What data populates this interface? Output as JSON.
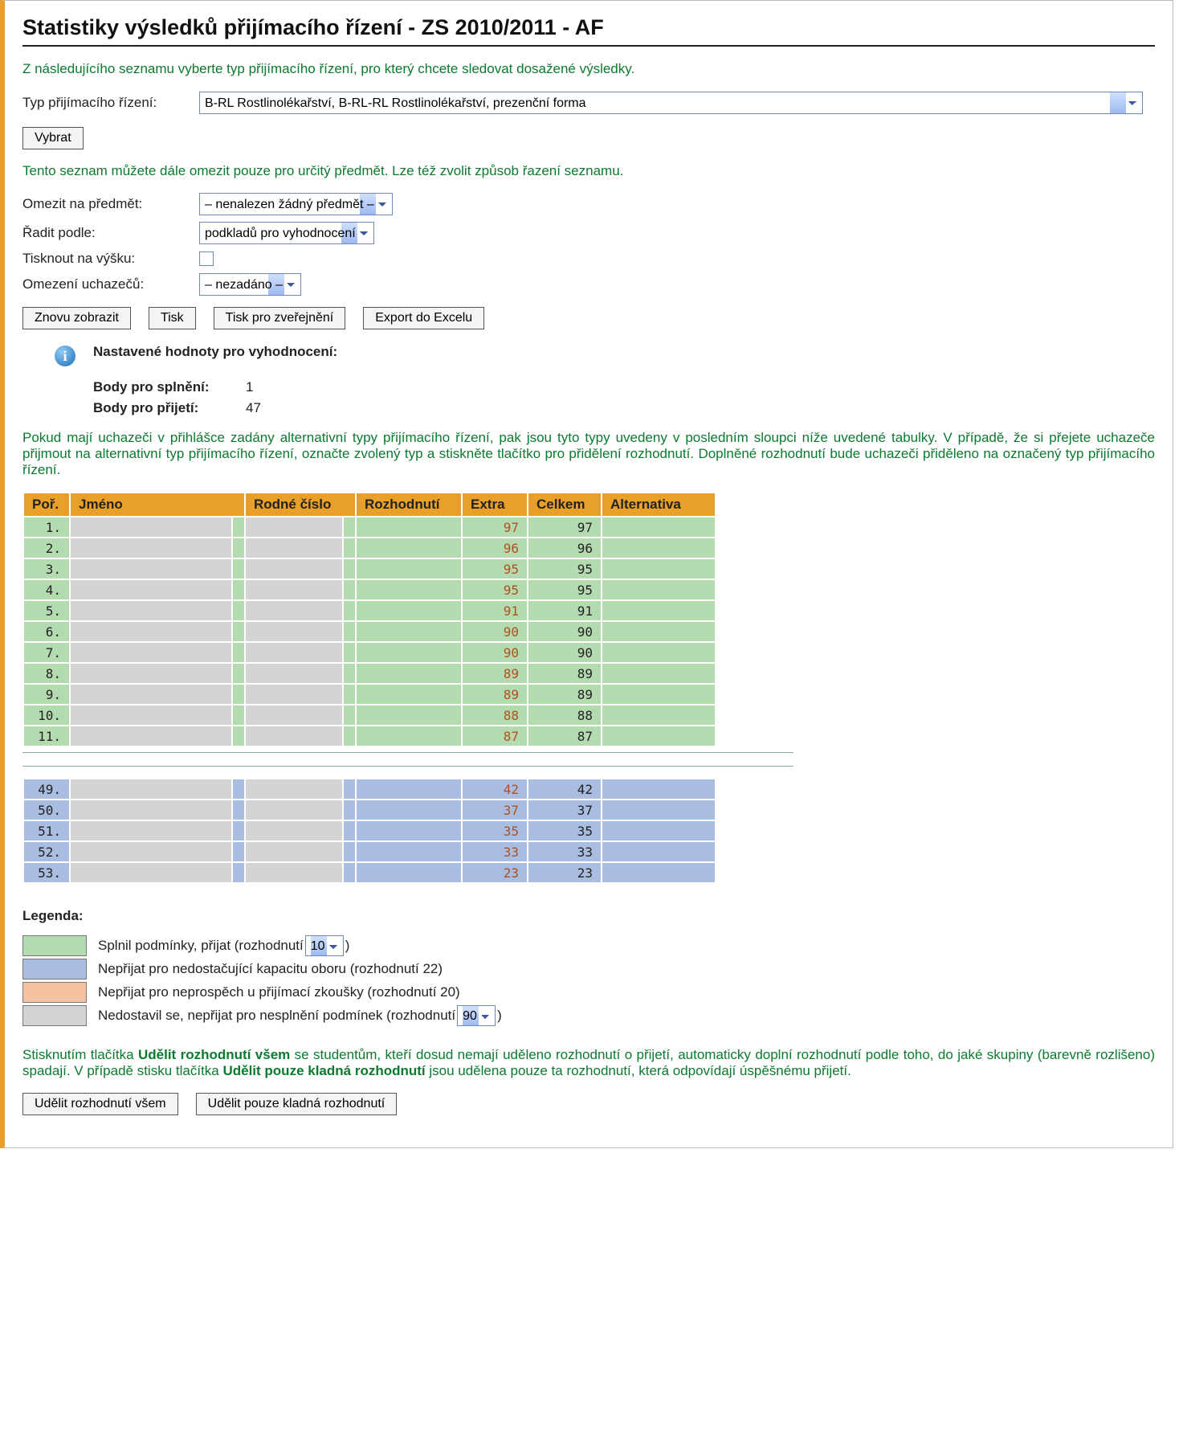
{
  "title": "Statistiky výsledků přijímacího řízení - ZS 2010/2011 - AF",
  "intro": "Z následujícího seznamu vyberte typ přijímacího řízení, pro který chcete sledovat dosažené výsledky.",
  "typeRow": {
    "label": "Typ přijímacího řízení:",
    "value": "B-RL Rostlinolékařství, B-RL-RL Rostlinolékařství, prezenční forma"
  },
  "btnSelect": "Vybrat",
  "limitNote": "Tento seznam můžete dále omezit pouze pro určitý předmět. Lze též zvolit způsob řazení seznamu.",
  "filters": {
    "subjectLabel": "Omezit na předmět:",
    "subjectValue": "– nenalezen žádný předmět –",
    "sortLabel": "Řadit podle:",
    "sortValue": "podkladů pro vyhodnocení",
    "printLabel": "Tisknout na výšku:",
    "limitAppLabel": "Omezení uchazečů:",
    "limitAppValue": "– nezadáno –"
  },
  "btns": {
    "refresh": "Znovu zobrazit",
    "print": "Tisk",
    "printPub": "Tisk pro zveřejnění",
    "export": "Export do Excelu"
  },
  "infoHeading": "Nastavené hodnoty pro vyhodnocení:",
  "infoKV": [
    {
      "k": "Body pro splnění:",
      "v": "1"
    },
    {
      "k": "Body pro přijetí:",
      "v": "47"
    }
  ],
  "altNote": "Pokud mají uchazeči v přihlášce zadány alternativní typy přijímacího řízení, pak jsou tyto typy uvedeny v posledním sloupci níže uvedené tabulky. V případě, že si přejete uchazeče přijmout na alternativní typ přijímacího řízení, označte zvolený typ a stiskněte tlačítko pro přidělení rozhodnutí. Doplněné rozhodnutí bude uchazeči přiděleno na označený typ přijímacího řízení.",
  "table": {
    "headers": [
      "Poř.",
      "Jméno",
      "Rodné číslo",
      "Rozhodnutí",
      "Extra",
      "Celkem",
      "Alternativa"
    ],
    "rowsTop": [
      {
        "n": "1.",
        "extra": "97",
        "celkem": "97"
      },
      {
        "n": "2.",
        "extra": "96",
        "celkem": "96"
      },
      {
        "n": "3.",
        "extra": "95",
        "celkem": "95"
      },
      {
        "n": "4.",
        "extra": "95",
        "celkem": "95"
      },
      {
        "n": "5.",
        "extra": "91",
        "celkem": "91"
      },
      {
        "n": "6.",
        "extra": "90",
        "celkem": "90"
      },
      {
        "n": "7.",
        "extra": "90",
        "celkem": "90"
      },
      {
        "n": "8.",
        "extra": "89",
        "celkem": "89"
      },
      {
        "n": "9.",
        "extra": "89",
        "celkem": "89"
      },
      {
        "n": "10.",
        "extra": "88",
        "celkem": "88"
      },
      {
        "n": "11.",
        "extra": "87",
        "celkem": "87"
      }
    ],
    "rowsBottom": [
      {
        "n": "49.",
        "extra": "42",
        "celkem": "42"
      },
      {
        "n": "50.",
        "extra": "37",
        "celkem": "37"
      },
      {
        "n": "51.",
        "extra": "35",
        "celkem": "35"
      },
      {
        "n": "52.",
        "extra": "33",
        "celkem": "33"
      },
      {
        "n": "53.",
        "extra": "23",
        "celkem": "23"
      }
    ]
  },
  "legend": {
    "title": "Legenda:",
    "items": [
      {
        "swatch": "green",
        "prefix": "Splnil podmínky, přijat (rozhodnutí ",
        "select": "10",
        "suffix": ")"
      },
      {
        "swatch": "blue",
        "text": "Nepřijat pro nedostačující kapacitu oboru (rozhodnutí 22)"
      },
      {
        "swatch": "orange",
        "text": "Nepřijat pro neprospěch u přijímací zkoušky (rozhodnutí 20)"
      },
      {
        "swatch": "gray",
        "prefix": "Nedostavil se, nepřijat pro nesplnění podmínek (rozhodnutí ",
        "select": "90",
        "suffix": ")"
      }
    ]
  },
  "grantNote": {
    "p1a": "Stisknutím tlačítka ",
    "b1": "Udělit rozhodnutí všem",
    "p1b": " se studentům, kteří dosud nemají uděleno rozhodnutí o přijetí, automaticky doplní rozhodnutí podle toho, do jaké skupiny (barevně rozlišeno) spadají. V případě stisku tlačítka ",
    "b2": "Udělit pouze kladná rozhodnutí",
    "p1c": " jsou udělena pouze ta rozhodnutí, která odpovídají úspěšnému přijetí."
  },
  "grantBtns": {
    "all": "Udělit rozhodnutí všem",
    "positive": "Udělit pouze kladná rozhodnutí"
  }
}
